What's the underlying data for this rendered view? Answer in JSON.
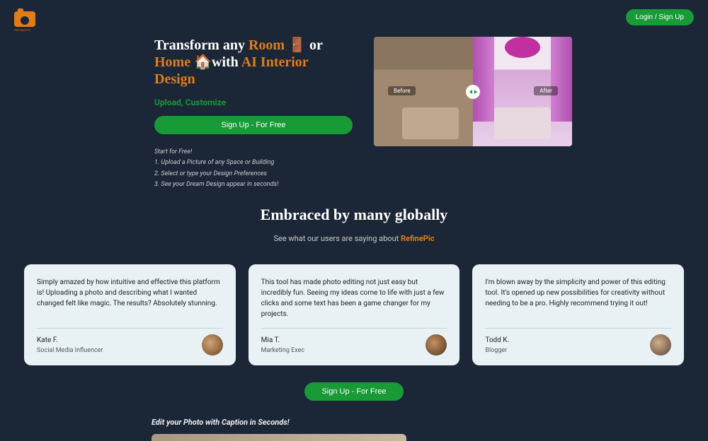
{
  "header": {
    "brand": "REFINEPIC",
    "login_label": "Login / Sign Up"
  },
  "hero": {
    "title_1": "Transform any ",
    "title_room": "Room 🚪",
    "title_or": " or ",
    "title_home": "Home 🏠",
    "title_with": "with ",
    "title_ai": "AI Interior Design",
    "tagline": "Upload, Customize",
    "signup_label": "Sign Up - For Free",
    "step_heading": "Start for Free!",
    "step_1": "1. Upload a Picture of any Space or Building",
    "step_2": "2. Select or type your Design Preferences",
    "step_3": "3. See your Dream Design appear in seconds!",
    "before_label": "Before",
    "after_label": "After"
  },
  "embraced": {
    "title": "Embraced by many globally",
    "subtitle_a": "See what our users are saying about ",
    "subtitle_brand": "RefinePic"
  },
  "testimonials": [
    {
      "text": "Simply amazed by how intuitive and effective this platform is! Uploading a photo and describing what I wanted changed felt like magic. The results? Absolutely stunning.",
      "name": "Kate F.",
      "role": "Social Media Influencer"
    },
    {
      "text": "This tool has made photo editing not just easy but incredibly fun. Seeing my ideas come to life with just a few clicks and some text has been a game changer for my projects.",
      "name": "Mia T.",
      "role": "Marketing Exec"
    },
    {
      "text": "I'm blown away by the simplicity and power of this editing tool. It's opened up new possibilities for creativity without needing to be a pro. Highly recommend trying it out!",
      "name": "Todd K.",
      "role": "Blogger"
    }
  ],
  "cta2": {
    "signup_label": "Sign Up - For Free"
  },
  "edit_section": {
    "caption": "Edit your Photo with Caption in Seconds!"
  }
}
